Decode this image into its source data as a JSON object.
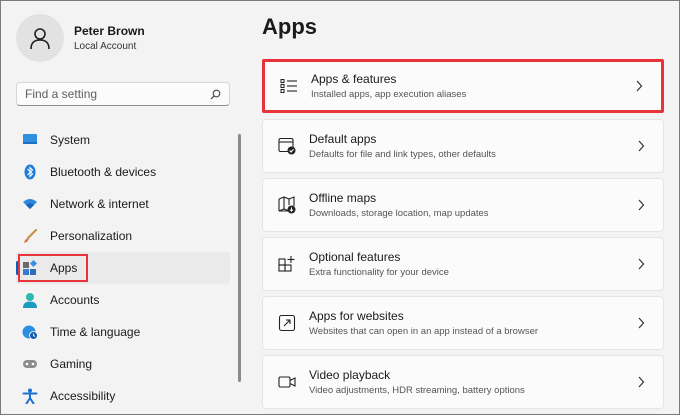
{
  "profile": {
    "name": "Peter Brown",
    "account_type": "Local Account"
  },
  "search": {
    "placeholder": "Find a setting"
  },
  "sidebar": {
    "items": [
      {
        "label": "System",
        "icon": "monitor-icon"
      },
      {
        "label": "Bluetooth & devices",
        "icon": "bluetooth-icon"
      },
      {
        "label": "Network & internet",
        "icon": "wifi-icon"
      },
      {
        "label": "Personalization",
        "icon": "brush-icon"
      },
      {
        "label": "Apps",
        "icon": "apps-icon",
        "active": true
      },
      {
        "label": "Accounts",
        "icon": "person-icon"
      },
      {
        "label": "Time & language",
        "icon": "globe-clock-icon"
      },
      {
        "label": "Gaming",
        "icon": "gamepad-icon"
      },
      {
        "label": "Accessibility",
        "icon": "accessibility-icon"
      }
    ]
  },
  "main": {
    "title": "Apps",
    "cards": [
      {
        "title": "Apps & features",
        "subtitle": "Installed apps, app execution aliases",
        "icon": "list-icon"
      },
      {
        "title": "Default apps",
        "subtitle": "Defaults for file and link types, other defaults",
        "icon": "default-apps-icon"
      },
      {
        "title": "Offline maps",
        "subtitle": "Downloads, storage location, map updates",
        "icon": "map-icon"
      },
      {
        "title": "Optional features",
        "subtitle": "Extra functionality for your device",
        "icon": "grid-plus-icon"
      },
      {
        "title": "Apps for websites",
        "subtitle": "Websites that can open in an app instead of a browser",
        "icon": "open-link-icon"
      },
      {
        "title": "Video playback",
        "subtitle": "Video adjustments, HDR streaming, battery options",
        "icon": "video-icon"
      }
    ]
  },
  "colors": {
    "accent": "#005fb8",
    "highlight": "#e8333b"
  }
}
